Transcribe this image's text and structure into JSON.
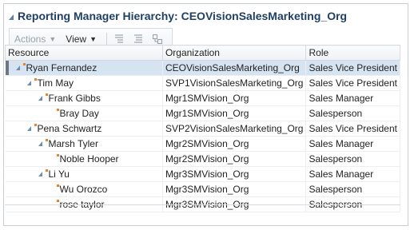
{
  "header": {
    "title": "Reporting Manager Hierarchy: CEOVisionSalesMarketing_Org"
  },
  "toolbar": {
    "actions_label": "Actions",
    "view_label": "View"
  },
  "columns": {
    "resource": "Resource",
    "organization": "Organization",
    "role": "Role"
  },
  "rows": [
    {
      "resource": "Ryan Fernandez",
      "organization": "CEOVisionSalesMarketing_Org",
      "role": "Sales Vice President",
      "level": 0,
      "expanded": true,
      "selected": true
    },
    {
      "resource": "Tim May",
      "organization": "SVP1VisionSalesMarketing_Org",
      "role": "Sales Vice President",
      "level": 1,
      "expanded": true
    },
    {
      "resource": "Frank Gibbs",
      "organization": "Mgr1SMVision_Org",
      "role": "Sales Manager",
      "level": 2,
      "expanded": true
    },
    {
      "resource": "Bray Day",
      "organization": "Mgr1SMVision_Org",
      "role": "Salesperson",
      "level": 3,
      "expanded": false
    },
    {
      "resource": "Pena Schwartz",
      "organization": "SVP2VisionSalesMarketing_Org",
      "role": "Sales Vice President",
      "level": 1,
      "expanded": true
    },
    {
      "resource": "Marsh Tyler",
      "organization": "Mgr2SMVision_Org",
      "role": "Sales Manager",
      "level": 2,
      "expanded": true
    },
    {
      "resource": "Noble Hooper",
      "organization": "Mgr2SMVision_Org",
      "role": "Salesperson",
      "level": 3,
      "expanded": false
    },
    {
      "resource": "Li Yu",
      "organization": "Mgr3SMVision_Org",
      "role": "Sales Manager",
      "level": 2,
      "expanded": true
    },
    {
      "resource": "Wu Orozco",
      "organization": "Mgr3SMVision_Org",
      "role": "Salesperson",
      "level": 3,
      "expanded": false
    },
    {
      "resource": "rose taylor",
      "organization": "Mgr3SMVision_Org",
      "role": "Salesperson",
      "level": 3,
      "expanded": false
    }
  ]
}
